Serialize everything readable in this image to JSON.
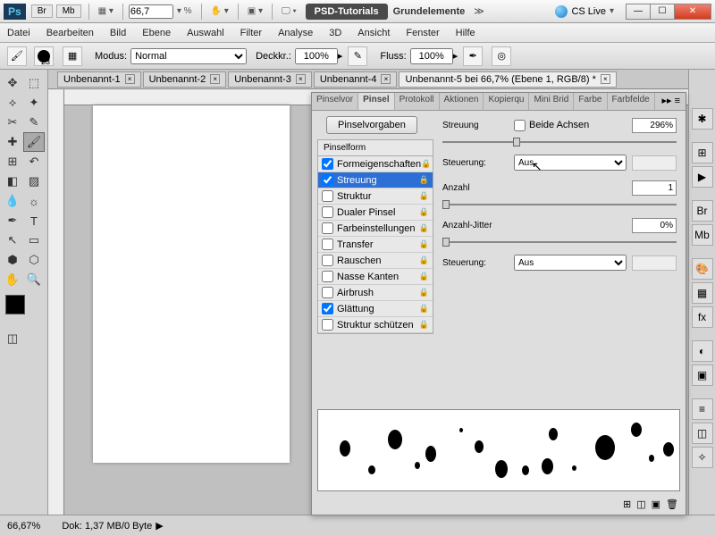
{
  "titlebar": {
    "zoom": "66,7",
    "tab": "PSD-Tutorials",
    "doc": "Grundelemente",
    "cslive": "CS Live"
  },
  "menu": [
    "Datei",
    "Bearbeiten",
    "Bild",
    "Ebene",
    "Auswahl",
    "Filter",
    "Analyse",
    "3D",
    "Ansicht",
    "Fenster",
    "Hilfe"
  ],
  "optbar": {
    "brushsize": "23",
    "modus_lbl": "Modus:",
    "modus": "Normal",
    "deck_lbl": "Deckkr.:",
    "deck": "100%",
    "fluss_lbl": "Fluss:",
    "fluss": "100%"
  },
  "doctabs": [
    {
      "label": "Unbenannt-1"
    },
    {
      "label": "Unbenannt-2"
    },
    {
      "label": "Unbenannt-3"
    },
    {
      "label": "Unbenannt-4"
    },
    {
      "label": "Unbenannt-5 bei 66,7% (Ebene 1, RGB/8) *",
      "active": true
    }
  ],
  "panel": {
    "tabs": [
      "Pinselvor",
      "Pinsel",
      "Protokoll",
      "Aktionen",
      "Kopierqu",
      "Mini Brid",
      "Farbe",
      "Farbfelde"
    ],
    "active_tab": "Pinsel",
    "preset_btn": "Pinselvorgaben",
    "section_hdr": "Pinselform",
    "rows": [
      {
        "label": "Formeigenschaften",
        "checked": true,
        "lock": true
      },
      {
        "label": "Streuung",
        "checked": true,
        "lock": true,
        "sel": true
      },
      {
        "label": "Struktur",
        "checked": false,
        "lock": true
      },
      {
        "label": "Dualer Pinsel",
        "checked": false,
        "lock": true
      },
      {
        "label": "Farbeinstellungen",
        "checked": false,
        "lock": true
      },
      {
        "label": "Transfer",
        "checked": false,
        "lock": true
      },
      {
        "label": "Rauschen",
        "checked": false,
        "lock": true
      },
      {
        "label": "Nasse Kanten",
        "checked": false,
        "lock": true
      },
      {
        "label": "Airbrush",
        "checked": false,
        "lock": true
      },
      {
        "label": "Glättung",
        "checked": true,
        "lock": true
      },
      {
        "label": "Struktur schützen",
        "checked": false,
        "lock": true
      }
    ],
    "controls": {
      "streuung_lbl": "Streuung",
      "beide_lbl": "Beide Achsen",
      "streuung_val": "296%",
      "steuerung_lbl": "Steuerung:",
      "steuerung_val": "Aus",
      "anzahl_lbl": "Anzahl",
      "anzahl_val": "1",
      "jitter_lbl": "Anzahl-Jitter",
      "jitter_val": "0%",
      "steuerung2_lbl": "Steuerung:",
      "steuerung2_val": "Aus"
    }
  },
  "status": {
    "zoom": "66,67%",
    "dok": "Dok: 1,37 MB/0 Byte"
  }
}
